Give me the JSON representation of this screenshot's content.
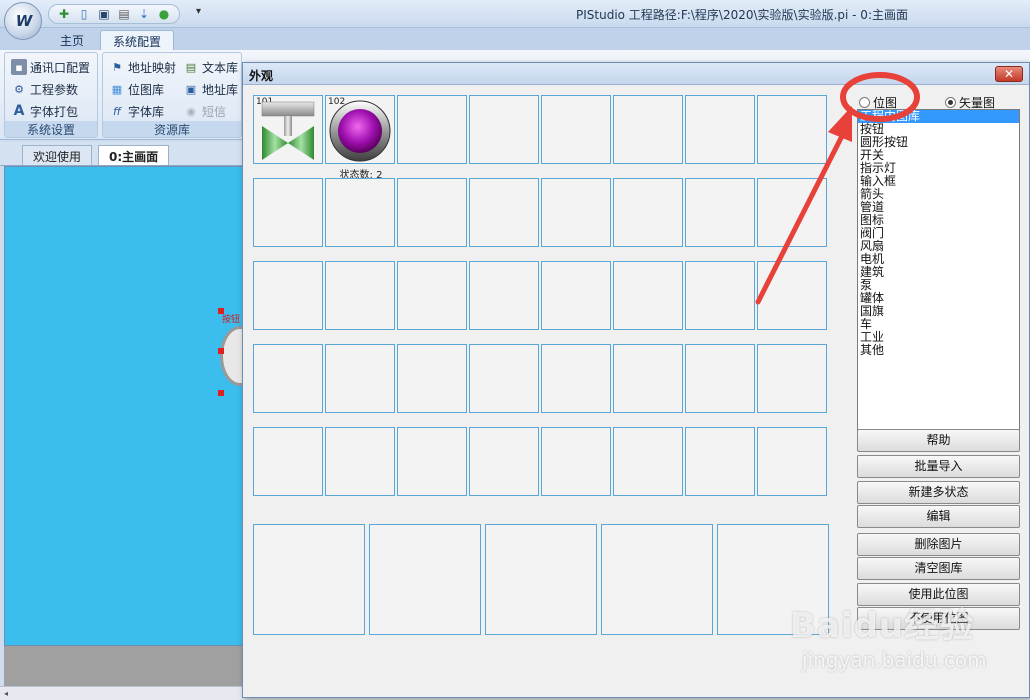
{
  "app": {
    "title": "PIStudio  工程路径:F:\\程序\\2020\\实验版\\实验版.pi  - 0:主画面",
    "logo_text": "W"
  },
  "ribbon": {
    "tabs": [
      {
        "label": "主页"
      },
      {
        "label": "系统配置"
      }
    ],
    "active_tab": "系统配置",
    "groups": [
      {
        "label": "系统设置",
        "items": [
          {
            "label": "通讯口配置"
          },
          {
            "label": "工程参数"
          },
          {
            "label": "字体打包"
          }
        ]
      },
      {
        "label": "资源库",
        "items": [
          {
            "label": "地址映射"
          },
          {
            "label": "位图库"
          },
          {
            "label": "字体库"
          },
          {
            "label": "文本库"
          },
          {
            "label": "地址库"
          },
          {
            "label": "短信"
          }
        ]
      }
    ]
  },
  "doc_tabs": [
    {
      "label": "欢迎使用"
    },
    {
      "label": "0:主画面"
    }
  ],
  "canvas": {
    "background": "#3bbdee",
    "object_label": "按钮"
  },
  "dialog": {
    "title": "外观",
    "close_label": "✕",
    "cells": {
      "first": {
        "id": "101"
      },
      "second": {
        "id": "102",
        "state_count": "状态数: 2"
      }
    },
    "view_mode": {
      "options": [
        {
          "label": "位图"
        },
        {
          "label": "矢量图"
        }
      ],
      "selected": "矢量图"
    },
    "categories": [
      "工程内图库",
      "按钮",
      "圆形按钮",
      "开关",
      "指示灯",
      "输入框",
      "箭头",
      "管道",
      "图标",
      "阀门",
      "风扇",
      "电机",
      "建筑",
      "泵",
      "罐体",
      "国旗",
      "车",
      "工业",
      "其他"
    ],
    "selected_category": "工程内图库",
    "buttons": [
      {
        "label": "帮助"
      },
      {
        "label": "批量导入"
      },
      {
        "label": "新建多状态"
      },
      {
        "label": "编辑"
      },
      {
        "label": "删除图片"
      },
      {
        "label": "清空图库"
      },
      {
        "label": "使用此位图"
      },
      {
        "label": "不使用位图"
      }
    ]
  },
  "annotation": {
    "color": "#e8413a"
  },
  "watermark": {
    "brand": "Baidu经验",
    "sub": "jingyan.baidu.com"
  }
}
